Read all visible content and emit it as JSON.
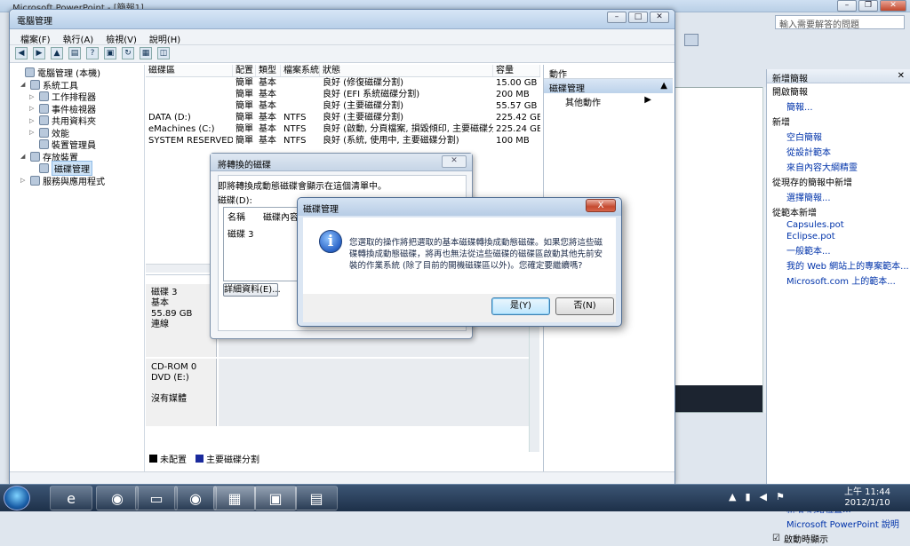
{
  "powerpoint": {
    "title": "Microsoft PowerPoint - [簡報1]",
    "search_placeholder": "輸入需要解答的問題",
    "taskpane_title": "新增簡報",
    "open_section": "開啟簡報",
    "open_more": "簡報...",
    "new_section": "新增",
    "blank": "空白簡報",
    "from_template": "從設計範本",
    "from_outline": "來自內容大綱精靈",
    "from_existing_section": "從現存的簡報中新增",
    "choose_presentation": "選擇簡報...",
    "from_template_section": "從範本新增",
    "tpl1": "Capsules.pot",
    "tpl2": "Eclipse.pot",
    "general_templates": "一般範本...",
    "web_templates": "我的 Web 網站上的專案範本...",
    "ms_templates": "Microsoft.com 上的範本...",
    "add_network": "新增 網路位置...",
    "help": "Microsoft PowerPoint 說明",
    "show_startup": "啟動時顯示"
  },
  "mmc": {
    "title": "電腦管理",
    "menu": [
      "檔案(F)",
      "執行(A)",
      "檢視(V)",
      "說明(H)"
    ],
    "tree": [
      {
        "label": "電腦管理 (本機)",
        "level": 0
      },
      {
        "label": "系統工具",
        "level": 1
      },
      {
        "label": "工作排程器",
        "level": 2
      },
      {
        "label": "事件檢視器",
        "level": 2
      },
      {
        "label": "共用資料夾",
        "level": 2
      },
      {
        "label": "效能",
        "level": 2
      },
      {
        "label": "裝置管理員",
        "level": 2
      },
      {
        "label": "存放裝置",
        "level": 1
      },
      {
        "label": "磁碟管理",
        "level": 2
      },
      {
        "label": "服務與應用程式",
        "level": 1
      }
    ],
    "columns": [
      "磁碟區",
      "配置",
      "類型",
      "檔案系統",
      "狀態",
      "容量"
    ],
    "volumes": [
      [
        "",
        "簡單",
        "基本",
        "",
        "良好 (修復磁碟分割)",
        "15.00 GB"
      ],
      [
        "",
        "簡單",
        "基本",
        "",
        "良好 (EFI 系統磁碟分割)",
        "200 MB"
      ],
      [
        "",
        "簡單",
        "基本",
        "",
        "良好 (主要磁碟分割)",
        "55.57 GB"
      ],
      [
        "DATA (D:)",
        "簡單",
        "基本",
        "NTFS",
        "良好 (主要磁碟分割)",
        "225.42 GB"
      ],
      [
        "eMachines (C:)",
        "簡單",
        "基本",
        "NTFS",
        "良好 (啟動, 分頁檔案, 損毀傾印, 主要磁碟分割)",
        "225.24 GB"
      ],
      [
        "SYSTEM RESERVED",
        "簡單",
        "基本",
        "NTFS",
        "良好 (系統, 使用中, 主要磁碟分割)",
        "100 MB"
      ]
    ],
    "disk3": {
      "name": "磁碟 3",
      "type": "基本",
      "size": "55.89 GB",
      "state": "連線"
    },
    "cdrom": {
      "name": "CD-ROM 0",
      "drive": "DVD (E:)",
      "state": "沒有媒體"
    },
    "legend_unalloc": "未配置",
    "legend_primary": "主要磁碟分割",
    "actions_header": "動作",
    "actions_section": "磁碟管理",
    "actions_more": "其他動作"
  },
  "convert_dialog": {
    "title": "將轉換的磁碟",
    "message": "即將轉換成動態磁碟會顯示在這個清單中。",
    "disks_label": "磁碟(D):",
    "col_name": "名稱",
    "col_content": "磁碟內容",
    "row": "磁碟 3",
    "details_button": "詳細資料(E)..."
  },
  "confirm_dialog": {
    "title": "磁碟管理",
    "message": "您選取的操作將把選取的基本磁碟轉換成動態磁碟。如果您將這些磁碟轉換成動態磁碟，將再也無法從這些磁碟的磁碟區啟動其他先前安裝的作業系統 (除了目前的開機磁碟區以外)。您確定要繼續嗎?",
    "yes": "是(Y)",
    "no": "否(N)",
    "close": "X"
  },
  "taskbar": {
    "time": "上午 11:44",
    "date": "2012/1/10"
  },
  "colors": {
    "unallocated": "#000000",
    "primary": "#1a2a9c"
  }
}
